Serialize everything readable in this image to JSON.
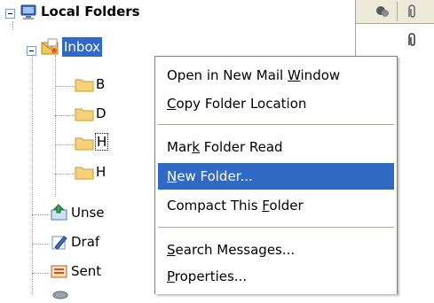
{
  "tree": {
    "root": {
      "label": "Local Folders"
    },
    "inbox": {
      "label": "Inbox"
    },
    "subfolders": [
      {
        "label": "B"
      },
      {
        "label": "D"
      },
      {
        "label": "H"
      },
      {
        "label": "H"
      }
    ],
    "folders": [
      {
        "label": "Unse",
        "icon": "unsent-icon"
      },
      {
        "label": "Draf",
        "icon": "drafts-icon"
      },
      {
        "label": "Sent",
        "icon": "sent-icon"
      }
    ]
  },
  "context_menu": {
    "items": [
      {
        "pre": "Open in New Mail ",
        "key": "W",
        "post": "indow"
      },
      {
        "pre": "",
        "key": "C",
        "post": "opy Folder Location"
      },
      {
        "pre": "Mar",
        "key": "k",
        "post": " Folder Read"
      },
      {
        "pre": "",
        "key": "N",
        "post": "ew Folder..."
      },
      {
        "pre": "Compact This ",
        "key": "F",
        "post": "older"
      },
      {
        "pre": "",
        "key": "S",
        "post": "earch Messages..."
      },
      {
        "pre": "",
        "key": "P",
        "post": "roperties..."
      }
    ],
    "highlighted_index": 3
  },
  "colors": {
    "selection": "#316ac5",
    "folder": "#f2c94c"
  }
}
